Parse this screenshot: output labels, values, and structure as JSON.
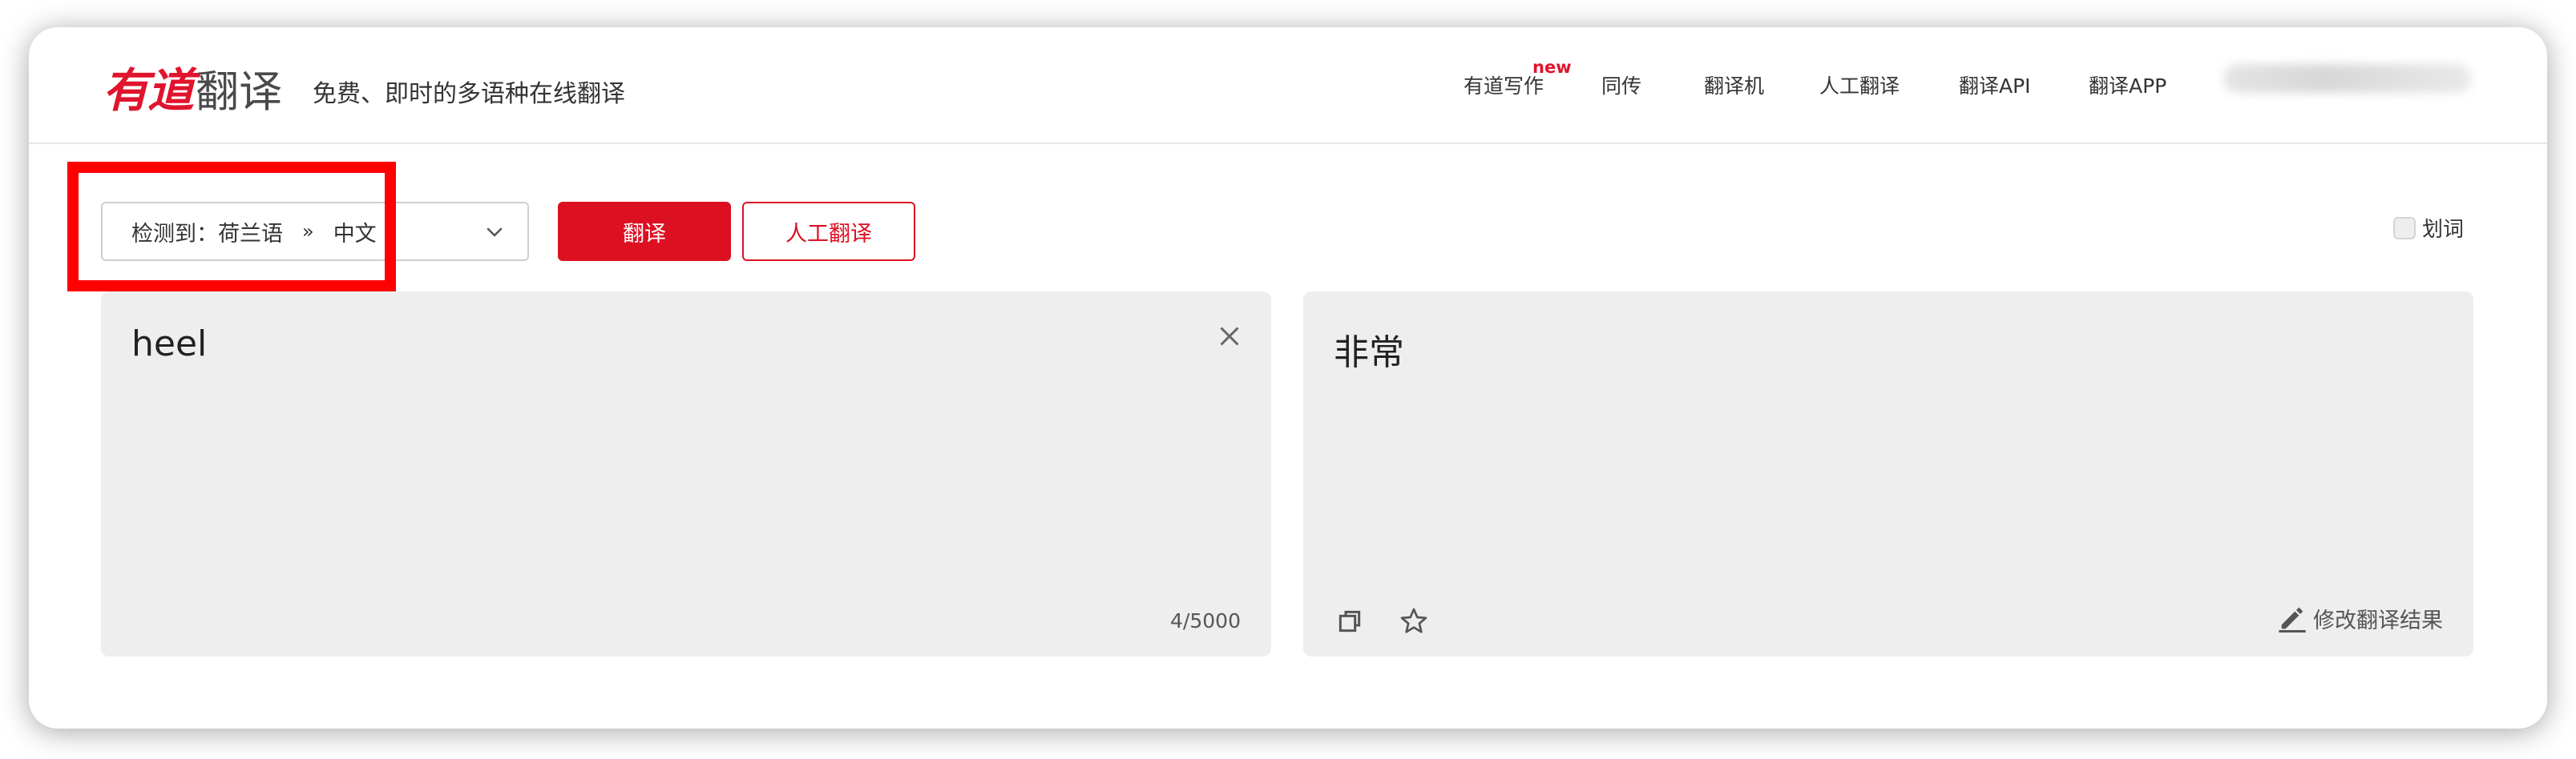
{
  "header": {
    "logo_main": "有道",
    "logo_sub": "翻译",
    "slogan": "免费、即时的多语种在线翻译",
    "nav": [
      {
        "label": "有道写作",
        "badge": "new"
      },
      {
        "label": "同传"
      },
      {
        "label": "翻译机"
      },
      {
        "label": "人工翻译"
      },
      {
        "label": "翻译API"
      },
      {
        "label": "翻译APP"
      }
    ]
  },
  "toolbar": {
    "lang_detect_label": "检测到：荷兰语",
    "lang_separator": "»",
    "lang_target": "中文",
    "translate_button": "翻译",
    "human_translate_button": "人工翻译",
    "word_pick_label": "划词"
  },
  "source": {
    "text": "heel",
    "counter": "4/5000"
  },
  "result": {
    "text": "非常",
    "edit_label": "修改翻译结果"
  },
  "colors": {
    "brand_red": "#dd1022",
    "highlight_red": "#ff0000",
    "panel_bg": "#eeeeee"
  },
  "icons": [
    "chevron-down-icon",
    "close-icon",
    "copy-icon",
    "star-icon",
    "pencil-icon"
  ]
}
